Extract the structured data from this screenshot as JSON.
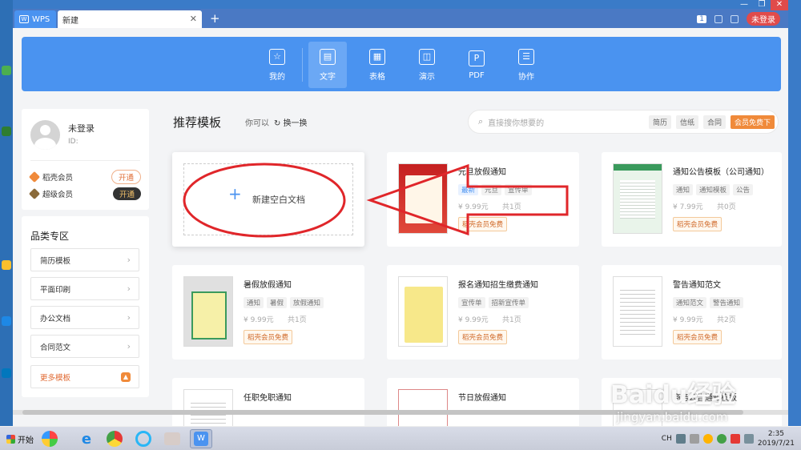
{
  "titlebar": {
    "wps_tab": "WPS",
    "doc_tab": "新建",
    "notif_count": "1",
    "login_label": "未登录"
  },
  "categories": [
    {
      "label": "我的",
      "icon": "star-icon"
    },
    {
      "label": "文字",
      "icon": "doc-icon"
    },
    {
      "label": "表格",
      "icon": "table-icon"
    },
    {
      "label": "演示",
      "icon": "presentation-icon"
    },
    {
      "label": "PDF",
      "icon": "pdf-icon"
    },
    {
      "label": "协作",
      "icon": "collab-icon"
    }
  ],
  "user": {
    "name": "未登录",
    "id_label": "ID:",
    "memberships": [
      {
        "label": "稻壳会员",
        "button": "开通",
        "color": "#f08a3a"
      },
      {
        "label": "超级会员",
        "button": "开通",
        "color": "#8a6a3a"
      }
    ]
  },
  "category_panel": {
    "title": "品类专区",
    "items": [
      "简历模板",
      "平面印刷",
      "办公文档",
      "合同范文"
    ],
    "more": "更多模板"
  },
  "main": {
    "title": "推荐模板",
    "subtitle": "你可以",
    "refresh": "换一换",
    "search_placeholder": "直接搜你想要的",
    "search_tags": [
      "简历",
      "信纸",
      "合同",
      "会员免费下"
    ]
  },
  "new_blank": {
    "label": "新建空白文档"
  },
  "cards": [
    {
      "title": "元旦放假通知",
      "tags": [
        "最新",
        "元旦",
        "宣传单"
      ],
      "price": "9.99元",
      "pages": "共1页",
      "vip": "稻壳会员免费"
    },
    {
      "title": "通知公告模板（公司通知）",
      "tags": [
        "通知",
        "通知模板",
        "公告"
      ],
      "price": "7.99元",
      "pages": "共0页",
      "vip": "稻壳会员免费"
    },
    {
      "title": "暑假放假通知",
      "tags": [
        "通知",
        "暑假",
        "放假通知"
      ],
      "price": "9.99元",
      "pages": "共1页",
      "vip": "稻壳会员免费"
    },
    {
      "title": "报名通知招生缴费通知",
      "tags": [
        "宣传单",
        "招新宣传单"
      ],
      "price": "9.99元",
      "pages": "共1页",
      "vip": "稻壳会员免费"
    },
    {
      "title": "警告通知范文",
      "tags": [
        "通知范文",
        "警告通知"
      ],
      "price": "9.99元",
      "pages": "共2页",
      "vip": "稻壳会员免费"
    },
    {
      "title": "任职免职通知",
      "tags": [],
      "price": "",
      "pages": "",
      "vip": ""
    },
    {
      "title": "节日放假通知",
      "tags": [],
      "price": "",
      "pages": "",
      "vip": ""
    },
    {
      "title": "商务公告通知模板",
      "tags": [],
      "price": "",
      "pages": "",
      "vip": ""
    }
  ],
  "taskbar": {
    "start": "开始",
    "lang": "CH",
    "time": "2:35",
    "date": "2019/7/21"
  },
  "watermark": {
    "logo": "Baidu经验",
    "sub": "jingyan.baidu.com"
  }
}
